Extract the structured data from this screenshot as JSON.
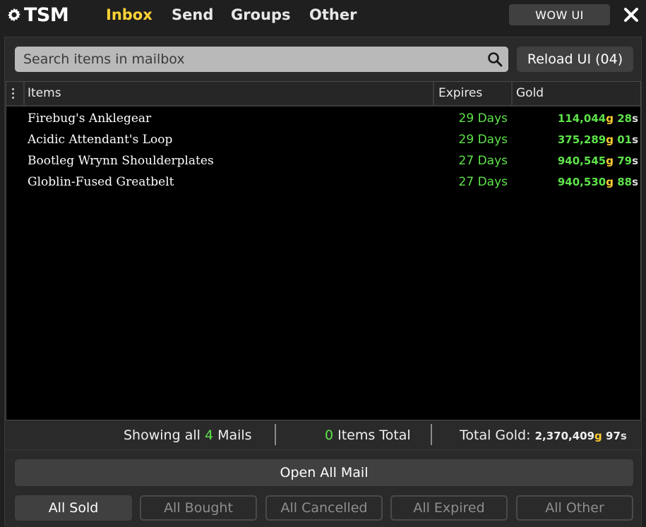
{
  "header": {
    "logo_text": "TSM",
    "tabs": [
      {
        "label": "Inbox",
        "active": true
      },
      {
        "label": "Send",
        "active": false
      },
      {
        "label": "Groups",
        "active": false
      },
      {
        "label": "Other",
        "active": false
      }
    ],
    "wow_ui_label": "WOW UI",
    "close_icon": "close-icon",
    "accent_color": "#ffd236"
  },
  "search": {
    "placeholder": "Search items in mailbox",
    "icon": "search-icon"
  },
  "reload_label": "Reload UI (04)",
  "table": {
    "columns": [
      "Items",
      "Expires",
      "Gold"
    ],
    "rows": [
      {
        "item": "Firebug's Anklegear",
        "expires": "29 Days",
        "gold": "114,044",
        "g": "g",
        "silver": "28",
        "s": "s"
      },
      {
        "item": "Acidic Attendant's Loop",
        "expires": "29 Days",
        "gold": "375,289",
        "g": "g",
        "silver": "01",
        "s": "s"
      },
      {
        "item": "Bootleg Wrynn Shoulderplates",
        "expires": "27 Days",
        "gold": "940,545",
        "g": "g",
        "silver": "79",
        "s": "s"
      },
      {
        "item": "Globlin-Fused Greatbelt",
        "expires": "27 Days",
        "gold": "940,530",
        "g": "g",
        "silver": "88",
        "s": "s"
      }
    ]
  },
  "status": {
    "showing_prefix": "Showing all ",
    "mail_count": "4",
    "showing_suffix": " Mails",
    "items_count": "0",
    "items_suffix": " Items Total",
    "total_gold_label": "Total Gold:",
    "total_gold": "2,370,409",
    "total_g": "g",
    "total_silver": "97",
    "total_s": "s"
  },
  "open_all_label": "Open All Mail",
  "filters": [
    {
      "label": "All Sold",
      "selected": true
    },
    {
      "label": "All Bought",
      "selected": false
    },
    {
      "label": "All Cancelled",
      "selected": false
    },
    {
      "label": "All Expired",
      "selected": false
    },
    {
      "label": "All Other",
      "selected": false
    }
  ]
}
